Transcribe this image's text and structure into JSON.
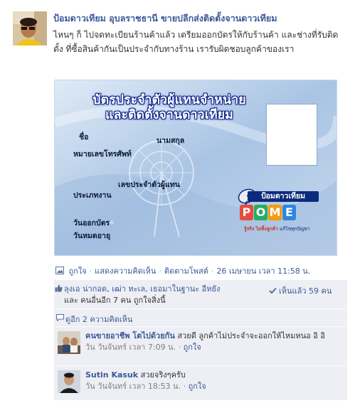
{
  "post": {
    "author": "ป้อมดาวเทียม อุบลราชธานี ขายปลีกส่งติดตั้งจานดาวเทียม",
    "message": "ไหนๆ ก็ ไปจดทะเบียนร้านค้าแล้ว เตรียมออกบัตรให้กับร้านค้า และช่างที่รับติดตั้ง ที่ซื้อสินค้ากันเป็นประจำกับทางร้าน เรารับผิดชอบลูกค้าของเรา"
  },
  "photo": {
    "title_line1": "บัตรประจำตัวผู้แทนจำหน่าย",
    "title_line2": "และติดตั้งจานดาวเทียม",
    "field_name": "ชื่อ",
    "field_surname": "นามสกุล",
    "field_phone": "หมายเลขโทรศัพท์",
    "field_agent_id": "เลขประจำตัวผู้แทน",
    "field_type": "ประเภทงาน",
    "field_issue_date": "วันออกบัตร",
    "field_expiry": "วันหมดอายุ",
    "logo_top": "ป้อมดาวเทียม",
    "logo_letters": [
      "P",
      "O",
      "M",
      "E"
    ],
    "logo_tag_red": "รู้จริง ไม่ทิ้งลูกค้า",
    "logo_tag_blue": "แก้ไขทุกปัญหา"
  },
  "actions": {
    "like": "ถูกใจ",
    "comment": "แสดงความคิดเห็น",
    "follow": "ติดตามโพสต์",
    "timestamp": "26 เมษายน เวลา 11:58 น."
  },
  "likes": {
    "line1": "ลุงเอ น่ากอด, เฒ่า ทะเล, เธอมาในฐานะ อีหยัง",
    "line2": "และ คนอื่นอีก 7 คน ถูกใจสิ่งนี้",
    "seen": "เห็นแล้ว 59 คน"
  },
  "comments_link": "ดูอีก 2 ความคิดเห็น",
  "comments": [
    {
      "name": "คนขายอาชีพ โตไปด้วยกัน",
      "text": "สวยดี ลูกค้าไม่ประจำจะออกให้ไหมหนอ อิ อิ",
      "time": "วัน วันจันทร์ เวลา 7:09 น.",
      "like": "ถูกใจ"
    },
    {
      "name": "Sutin Kasuk",
      "text": "สวยจริงๆครับ",
      "time": "วัน วันจันทร์ เวลา 18:53 น.",
      "like": "ถูกใจ"
    }
  ],
  "colors": {
    "link": "#3b5998",
    "ufi_bg": "#edeff4",
    "card_title_outline": "#0a1f8a",
    "logo_P": "#e74c3c",
    "logo_O": "#27ae60",
    "logo_M": "#f39c12",
    "logo_E": "#2e86de"
  }
}
